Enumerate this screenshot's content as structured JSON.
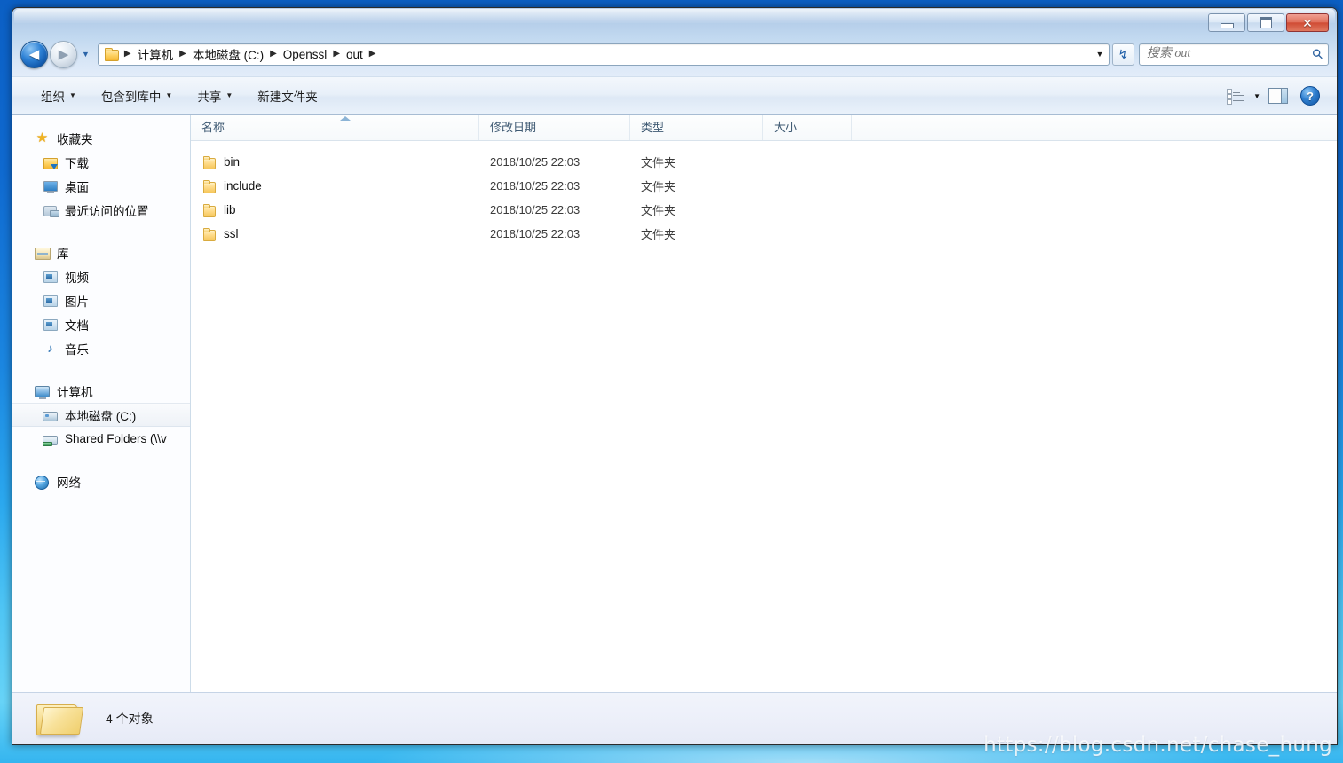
{
  "window": {
    "caption": {
      "minimize_label": "最小化",
      "maximize_label": "最大化",
      "close_label": "✕"
    }
  },
  "address_bar": {
    "back_label": "◀",
    "forward_label": "▶",
    "history_caret": "▼",
    "folder_icon": "folder-icon",
    "crumbs": [
      "计算机",
      "本地磁盘 (C:)",
      "Openssl",
      "out"
    ],
    "separator": "▶",
    "dropdown_caret": "▼",
    "refresh_label": "↯"
  },
  "search": {
    "placeholder": "搜索 out",
    "value": "",
    "icon": "search-icon"
  },
  "command_bar": {
    "items": [
      {
        "label": "组织",
        "caret": "▼"
      },
      {
        "label": "包含到库中",
        "caret": "▼"
      },
      {
        "label": "共享",
        "caret": "▼"
      },
      {
        "label": "新建文件夹",
        "caret": ""
      }
    ],
    "views_caret": "▼",
    "help_label": "?"
  },
  "nav_pane": {
    "groups": [
      {
        "header": {
          "label": "收藏夹",
          "icon": "star-icon"
        },
        "children": [
          {
            "label": "下载",
            "icon": "downloads-folder-icon"
          },
          {
            "label": "桌面",
            "icon": "desktop-icon"
          },
          {
            "label": "最近访问的位置",
            "icon": "recent-places-icon"
          }
        ]
      },
      {
        "header": {
          "label": "库",
          "icon": "library-icon"
        },
        "children": [
          {
            "label": "视频",
            "icon": "videos-icon"
          },
          {
            "label": "图片",
            "icon": "pictures-icon"
          },
          {
            "label": "文档",
            "icon": "documents-icon"
          },
          {
            "label": "音乐",
            "icon": "music-icon"
          }
        ]
      },
      {
        "header": {
          "label": "计算机",
          "icon": "computer-icon"
        },
        "children": [
          {
            "label": "本地磁盘 (C:)",
            "icon": "local-disk-icon",
            "selected": true
          },
          {
            "label": "Shared Folders (\\\\v",
            "icon": "network-drive-icon"
          }
        ]
      },
      {
        "header": {
          "label": "网络",
          "icon": "network-globe-icon"
        },
        "children": []
      }
    ]
  },
  "file_list": {
    "columns": [
      {
        "key": "name",
        "label": "名称",
        "sorted": "asc"
      },
      {
        "key": "date",
        "label": "修改日期"
      },
      {
        "key": "type",
        "label": "类型"
      },
      {
        "key": "size",
        "label": "大小"
      }
    ],
    "rows": [
      {
        "name": "bin",
        "date": "2018/10/25 22:03",
        "type": "文件夹",
        "size": "",
        "icon": "folder-icon"
      },
      {
        "name": "include",
        "date": "2018/10/25 22:03",
        "type": "文件夹",
        "size": "",
        "icon": "folder-icon"
      },
      {
        "name": "lib",
        "date": "2018/10/25 22:03",
        "type": "文件夹",
        "size": "",
        "icon": "folder-icon"
      },
      {
        "name": "ssl",
        "date": "2018/10/25 22:03",
        "type": "文件夹",
        "size": "",
        "icon": "folder-icon"
      }
    ]
  },
  "status_bar": {
    "text": "4 个对象",
    "icon": "folder-large-icon"
  },
  "watermark": {
    "text": "https://blog.csdn.net/chase_hung"
  },
  "colors": {
    "desktop_top": "#0b5fc4",
    "desktop_bottom": "#4fc5f4",
    "glass": "#b8cfea",
    "accent_blue": "#2a64a8",
    "close_red": "#cf4a33",
    "folder_yellow": "#f5b731",
    "header_text": "#3f5a73"
  }
}
